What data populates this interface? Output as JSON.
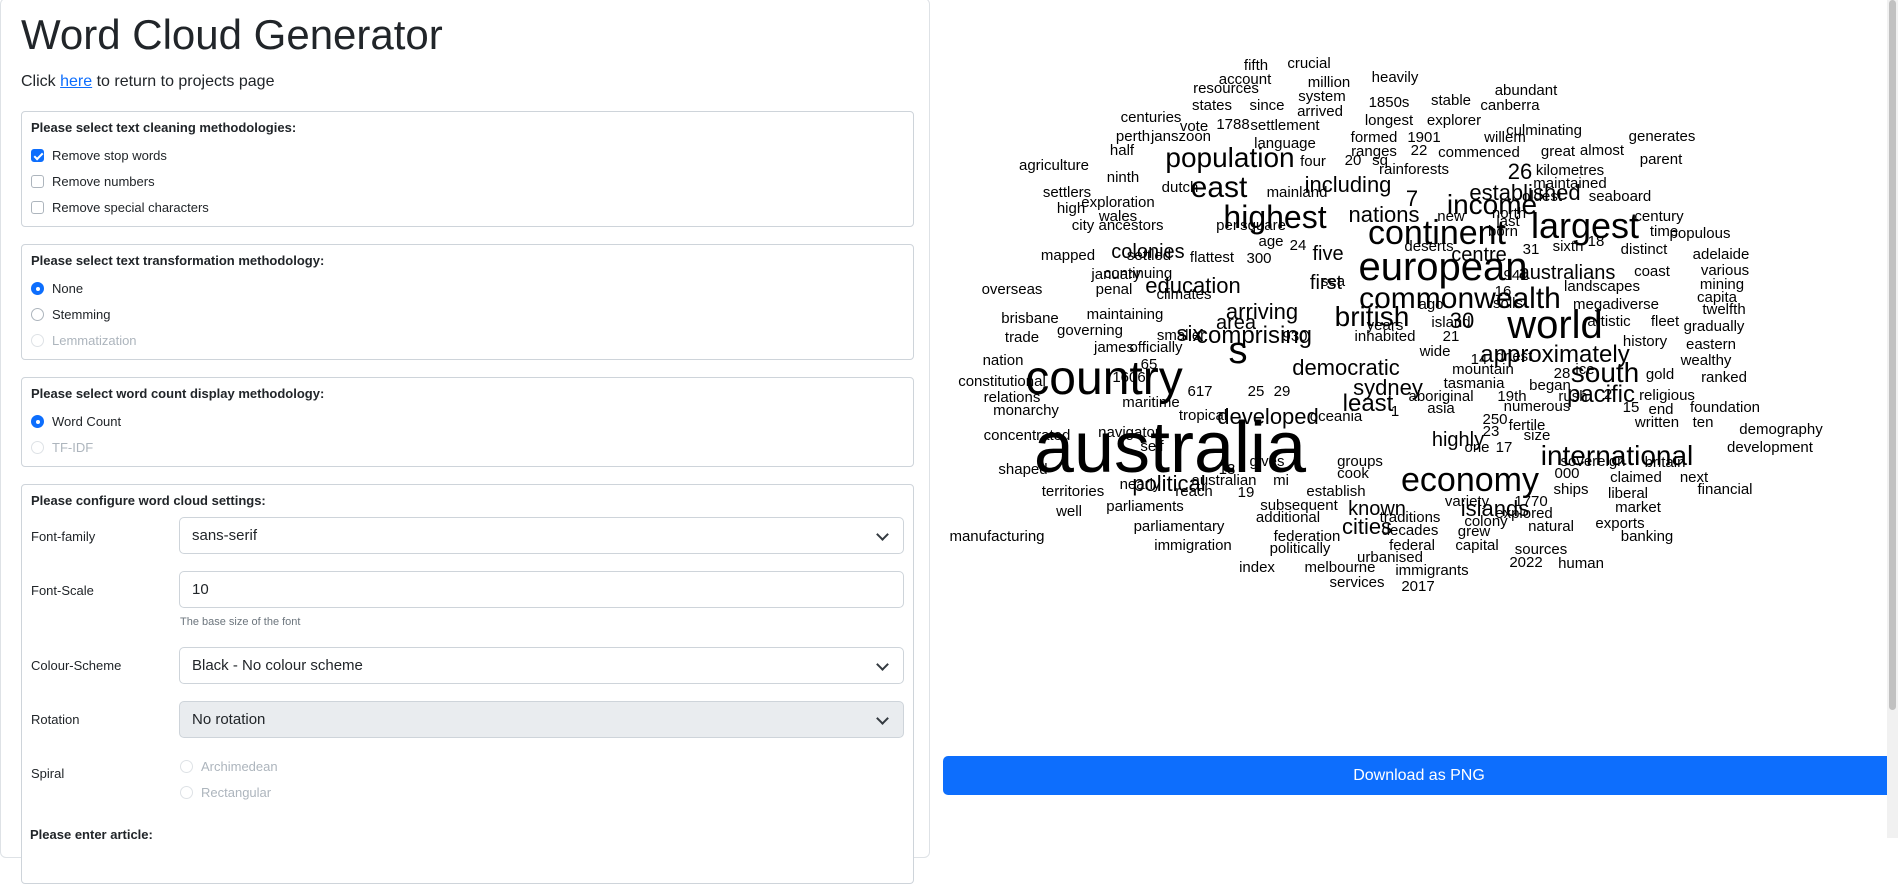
{
  "page": {
    "title": "Word Cloud Generator",
    "return_prefix": "Click ",
    "return_link": "here",
    "return_suffix": " to return to projects page"
  },
  "cleaning": {
    "legend": "Please select text cleaning methodologies:",
    "options": [
      {
        "label": "Remove stop words",
        "checked": true
      },
      {
        "label": "Remove numbers",
        "checked": false
      },
      {
        "label": "Remove special characters",
        "checked": false
      }
    ]
  },
  "transformation": {
    "legend": "Please select text transformation methodology:",
    "options": [
      {
        "label": "None",
        "selected": true,
        "disabled": false
      },
      {
        "label": "Stemming",
        "selected": false,
        "disabled": false
      },
      {
        "label": "Lemmatization",
        "selected": false,
        "disabled": true
      }
    ]
  },
  "count_display": {
    "legend": "Please select word count display methodology:",
    "options": [
      {
        "label": "Word Count",
        "selected": true,
        "disabled": false
      },
      {
        "label": "TF-IDF",
        "selected": false,
        "disabled": true
      }
    ]
  },
  "settings": {
    "legend": "Please configure word cloud settings:",
    "font_family_label": "Font-family",
    "font_family_value": "sans-serif",
    "font_scale_label": "Font-Scale",
    "font_scale_value": "10",
    "font_scale_help": "The base size of the font",
    "colour_scheme_label": "Colour-Scheme",
    "colour_scheme_value": "Black - No colour scheme",
    "rotation_label": "Rotation",
    "rotation_value": "No rotation",
    "spiral_label": "Spiral",
    "spiral_options": [
      "Archimedean",
      "Rectangular"
    ]
  },
  "article_section_label": "Please enter article:",
  "download_label": "Download as PNG",
  "word_cloud_words": [
    "australia",
    "country",
    "s",
    "world",
    "european",
    "economy",
    "continent",
    "commonwealth",
    "highest",
    "largest",
    "east",
    "income",
    "population",
    "international",
    "south",
    "british",
    "approximately",
    "comprising",
    "pacific",
    "political",
    "least",
    "democratic",
    "sydney",
    "developed",
    "established",
    "including",
    "nations",
    "colonies",
    "education",
    "arriving",
    "australians",
    "highly",
    "islands",
    "known",
    "cities",
    "area",
    "six",
    "first",
    "five",
    "centre",
    "26",
    "30",
    "7",
    "mapped",
    "january",
    "overseas",
    "brisbane",
    "trade",
    "nation",
    "constitutional",
    "relations",
    "monarchy",
    "concentrated",
    "shaped",
    "territories",
    "well",
    "manufacturing",
    "fifth",
    "crucial",
    "account",
    "resources",
    "million",
    "heavily",
    "system",
    "abundant",
    "states",
    "since",
    "1850s",
    "stable",
    "canberra",
    "arrived",
    "longest",
    "explorer",
    "centuries",
    "vote",
    "1788",
    "settlement",
    "culminating",
    "perth",
    "janszoon",
    "formed",
    "1901",
    "willem",
    "generates",
    "half",
    "language",
    "ranges",
    "22",
    "commenced",
    "great",
    "almost",
    "agriculture",
    "four",
    "20",
    "sq",
    "parent",
    "rainforests",
    "kilometres",
    "ninth",
    "dutch",
    "maintained",
    "settlers",
    "mainland",
    "oldest",
    "seaboard",
    "high",
    "exploration",
    "wales",
    "north",
    "century",
    "city",
    "ancestors",
    "per",
    "square",
    "new",
    "last",
    "born",
    "time",
    "populous",
    "age",
    "24",
    "deserts",
    "31",
    "sixth",
    "18",
    "distinct",
    "settled",
    "flattest",
    "300",
    "adelaide",
    "continuing",
    "sea",
    "941",
    "coast",
    "various",
    "penal",
    "climates",
    "16",
    "landscapes",
    "mining",
    "capita",
    "soils",
    "megadiverse",
    "twelfth",
    "ago",
    "maintaining",
    "island",
    "artistic",
    "fleet",
    "gradually",
    "governing",
    "years",
    "smaller",
    "930",
    "inhabited",
    "21",
    "history",
    "eastern",
    "james",
    "officially",
    "wide",
    "14",
    "driest",
    "wealthy",
    "65",
    "mountain",
    "28",
    "ice",
    "gold",
    "ranked",
    "1606",
    "tasmania",
    "began",
    "617",
    "25",
    "29",
    "aboriginal",
    "19th",
    "rush",
    "2",
    "religious",
    "maritime",
    "asia",
    "numerous",
    "15",
    "end",
    "foundation",
    "tropical",
    "oceania",
    "1",
    "250",
    "fertile",
    "written",
    "ten",
    "navigator",
    "23",
    "size",
    "demography",
    "self",
    "one",
    "17",
    "development",
    "gives",
    "groups",
    "sovereign",
    "britain",
    "13",
    "cook",
    "000",
    "claimed",
    "next",
    "nearly",
    "australian",
    "mi",
    "establish",
    "ships",
    "liberal",
    "financial",
    "reach",
    "19",
    "variety",
    "1770",
    "parliaments",
    "subsequent",
    "market",
    "additional",
    "explored",
    "exports",
    "traditions",
    "colony",
    "natural",
    "parliamentary",
    "federation",
    "decades",
    "grew",
    "banking",
    "immigration",
    "politically",
    "federal",
    "capital",
    "sources",
    "urbanised",
    "2022",
    "human",
    "index",
    "melbourne",
    "immigrants",
    "services",
    "2017"
  ]
}
